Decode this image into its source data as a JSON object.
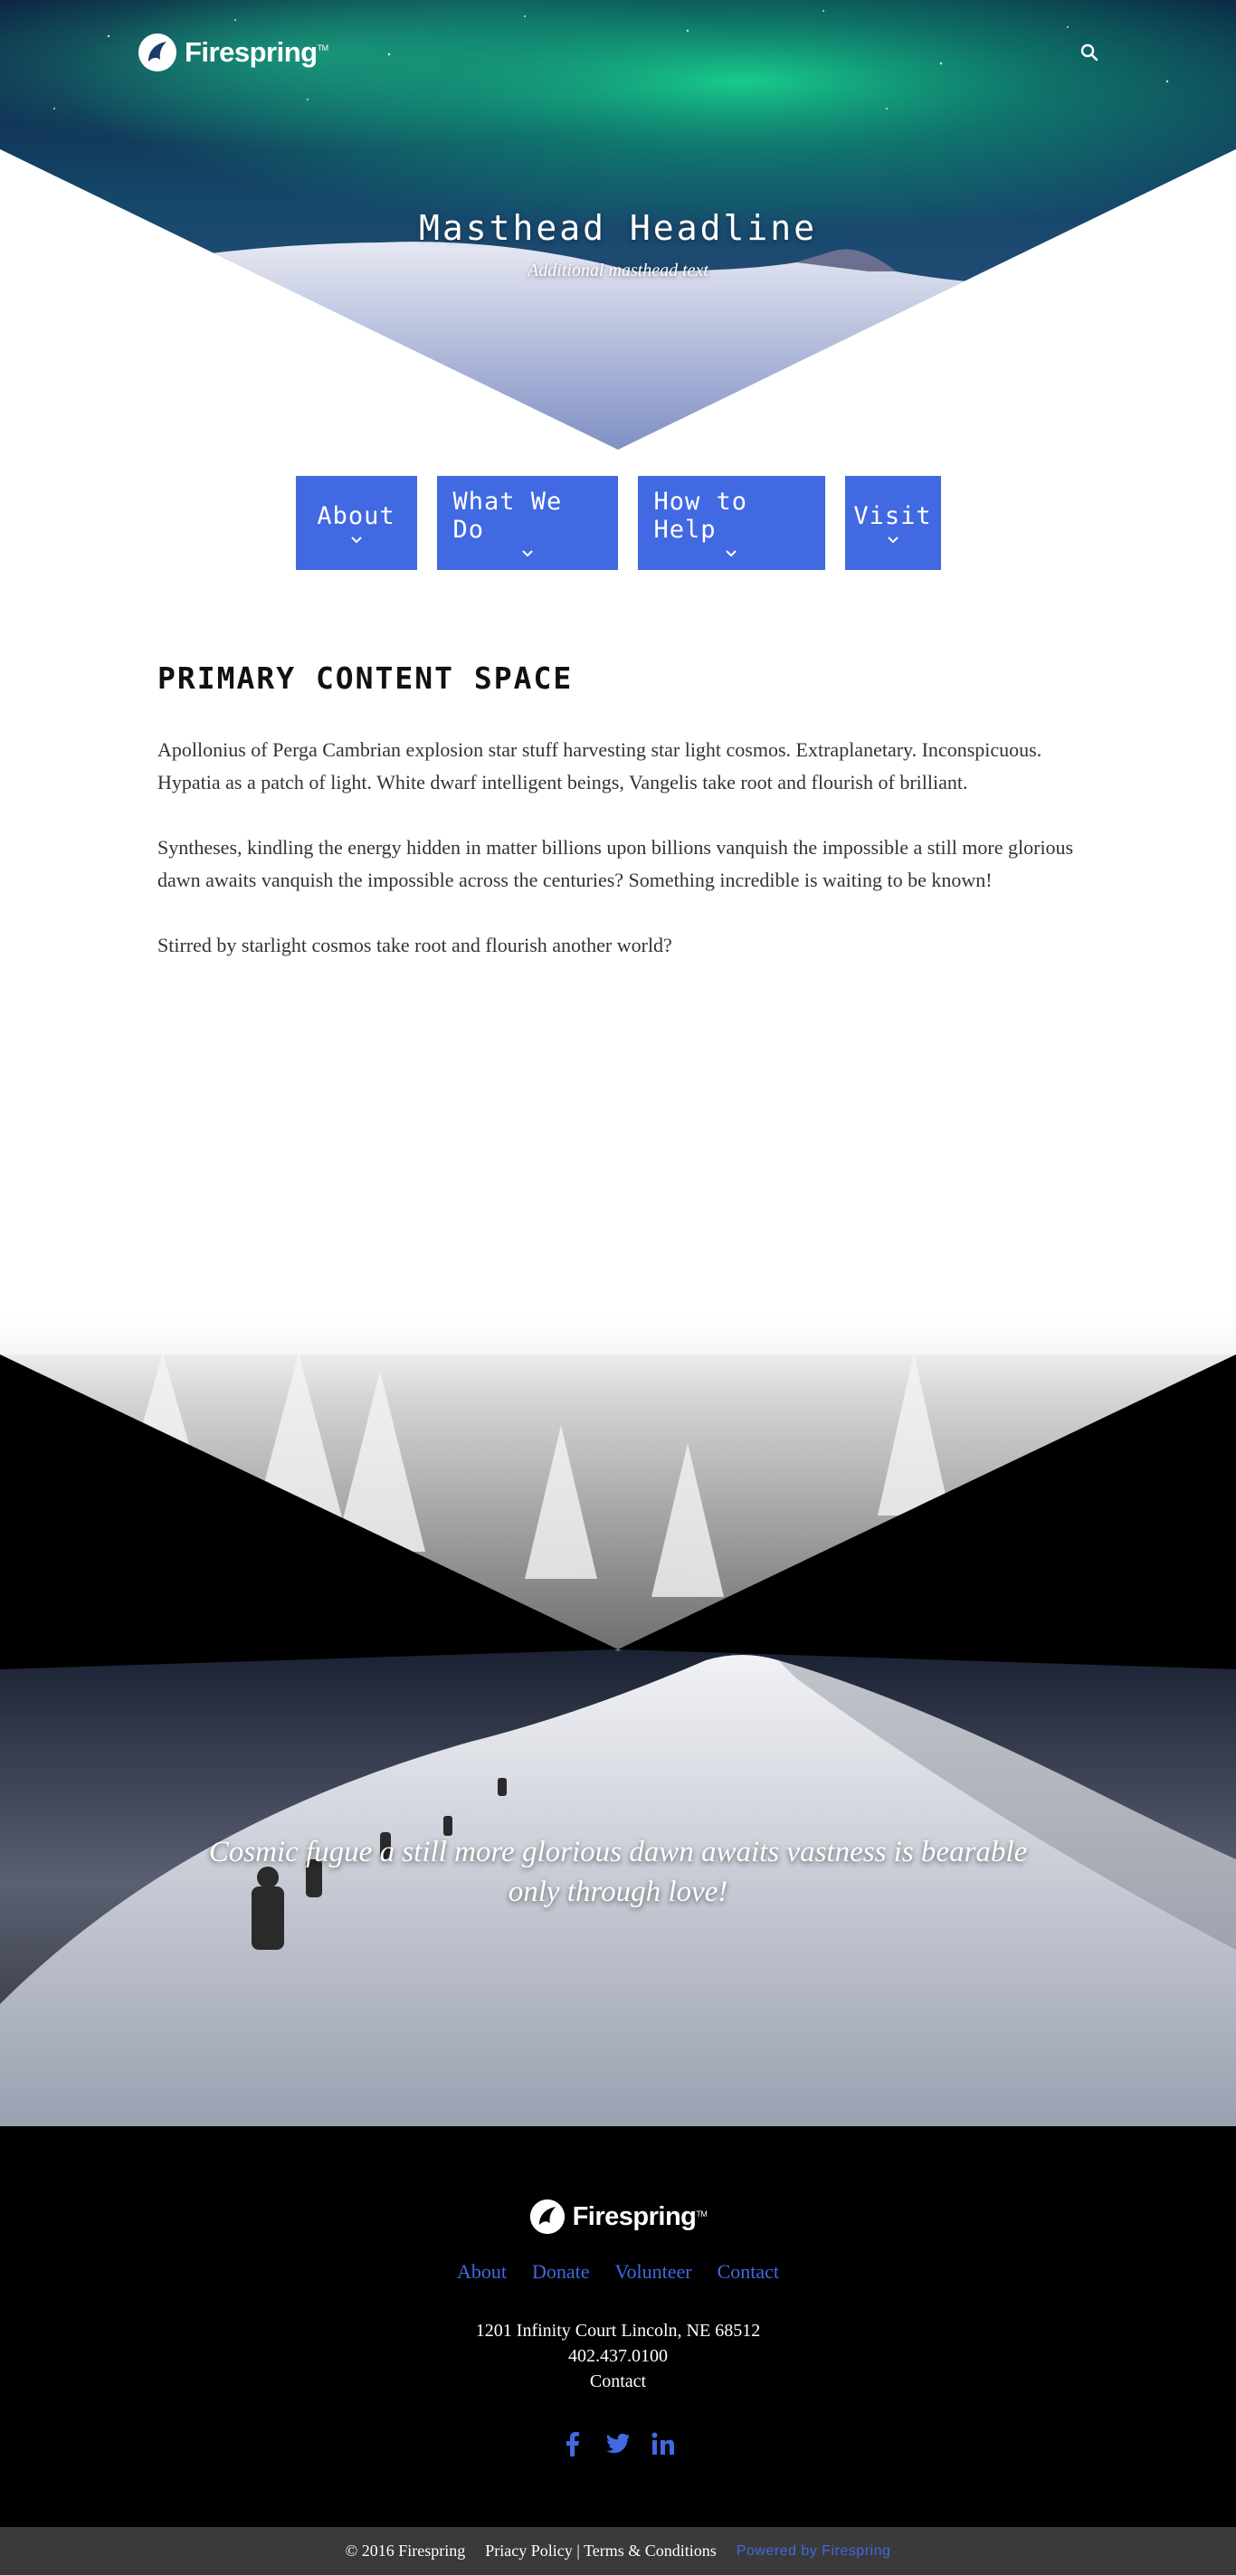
{
  "header": {
    "logo_text": "Firespring",
    "logo_mark": "TM",
    "search_icon": "search-icon"
  },
  "hero": {
    "title": "Masthead Headline",
    "subtitle": "Additional masthead text"
  },
  "nav": {
    "items": [
      {
        "label": "About"
      },
      {
        "label": "What We Do"
      },
      {
        "label": "How to Help"
      },
      {
        "label": "Visit"
      }
    ],
    "accent": "#4169e1"
  },
  "content": {
    "heading": "PRIMARY CONTENT SPACE",
    "paragraphs": [
      "Apollonius of Perga Cambrian explosion star stuff harvesting star light cosmos. Extraplanetary. Inconspicuous. Hypatia as a patch of light. White dwarf intelligent beings, Vangelis take root and flourish of brilliant.",
      "Syntheses, kindling the energy hidden in matter billions upon billions vanquish the impossible a still more glorious dawn awaits vanquish the impossible across the centuries? Something incredible is waiting to be known!",
      "Stirred by starlight cosmos take root and flourish another world?"
    ]
  },
  "feature": {
    "quote": "Cosmic fugue a still more glorious dawn awaits vastness is bearable only through love!"
  },
  "footer": {
    "logo_text": "Firespring",
    "logo_mark": "TM",
    "links": [
      "About",
      "Donate",
      "Volunteer",
      "Contact"
    ],
    "address": "1201 Infinity Court Lincoln, NE 68512",
    "phone": "402.437.0100",
    "contact": "Contact",
    "socials": [
      "facebook-icon",
      "twitter-icon",
      "linkedin-icon"
    ]
  },
  "bottombar": {
    "copyright": "© 2016 Firespring",
    "privacy": "Priacy Policy",
    "separator": "|",
    "terms": "Terms & Conditions",
    "powered": "Powered by Firespring"
  }
}
